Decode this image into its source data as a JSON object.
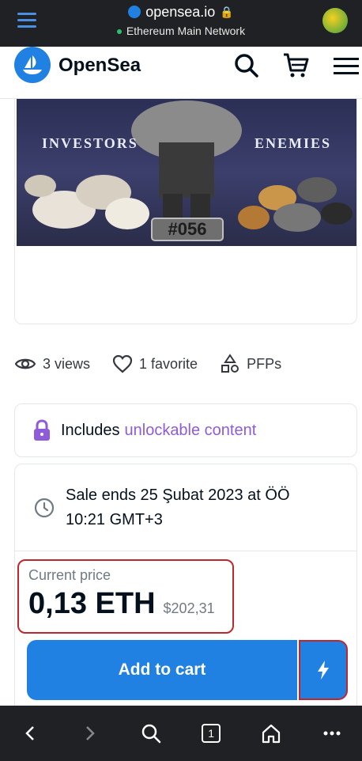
{
  "browser": {
    "url": "opensea.io",
    "network": "Ethereum Main Network",
    "back_icon": "back-arrow-icon",
    "forward_icon": "forward-arrow-icon",
    "tabs_count": "1"
  },
  "header": {
    "brand": "OpenSea"
  },
  "nft": {
    "left_word": "Investors",
    "right_word": "Enemies",
    "number": "#056"
  },
  "stats": {
    "views": "3 views",
    "favorites": "1 favorite",
    "category": "PFPs"
  },
  "unlockable": {
    "prefix": "Includes",
    "link": "unlockable content"
  },
  "sale": {
    "ends": "Sale ends 25 Şubat 2023 at ÖÖ 10:21 GMT+3",
    "price_label": "Current price",
    "price_eth": "0,13 ETH",
    "price_usd": "$202,31",
    "add_to_cart": "Add to cart"
  },
  "colors": {
    "accent": "#2081e2",
    "highlight": "#c0272d",
    "unlock_link": "#8e5cd9"
  }
}
